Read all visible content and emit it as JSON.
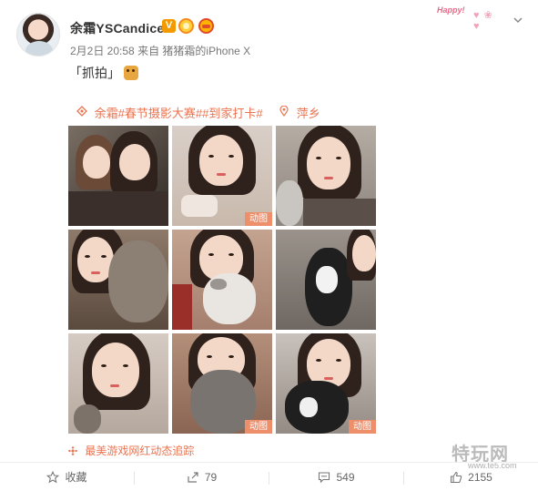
{
  "user": {
    "name": "余霜YSCandice",
    "verified_badge": "V",
    "avatar_icon": "avatar-illustration-icon"
  },
  "meta": {
    "date": "2月2日 20:58",
    "from_label": "来自",
    "device": "猪猪霜的iPhone X"
  },
  "post": {
    "text": "「抓拍」"
  },
  "topics": {
    "tag_text": "余霜#春节摄影大赛##到家打卡#",
    "location": "萍乡"
  },
  "grid": {
    "gif_label": "动图"
  },
  "source": {
    "text": "最美游戏网红动态追踪"
  },
  "actions": {
    "favorite": "收藏",
    "repost": "79",
    "comment": "549",
    "like": "2155"
  },
  "watermark": {
    "text": "特玩网"
  },
  "decoration": {
    "happy": "Happy!"
  },
  "colors": {
    "accent": "#eb7350",
    "gif_badge": "#ee8f6c",
    "verified": "#f39a00"
  }
}
